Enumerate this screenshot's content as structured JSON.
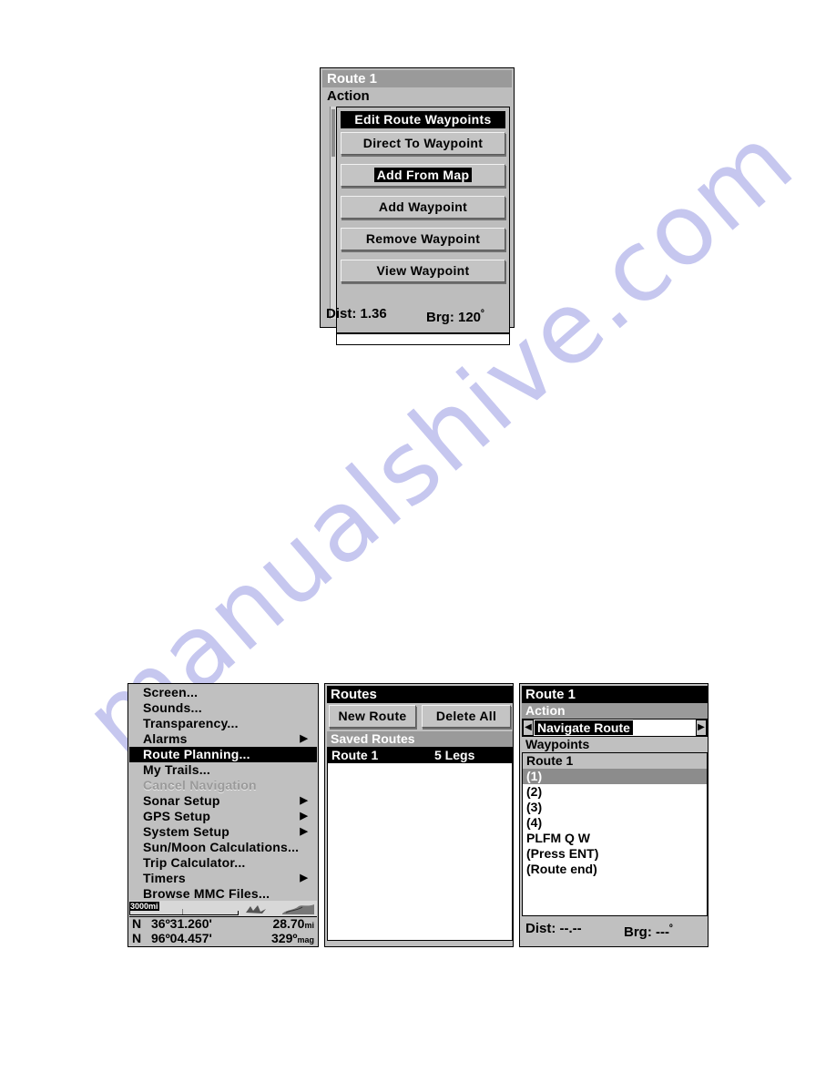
{
  "watermark": {
    "text": "manualshive.com"
  },
  "colors": {
    "lcd_background": "#c0c0c0",
    "selected_black": "#000000",
    "header_gray": "#9a9a9a",
    "row_gray": "#8c8c8c",
    "button_face": "#c4c4c4",
    "watermark_purple": "#c6c7ef"
  },
  "route_action_dialog": {
    "title": "Route 1",
    "section_label": "Action",
    "menu_items": [
      {
        "label": "Edit Route Waypoints",
        "style": "selected"
      },
      {
        "label": "Direct To Waypoint",
        "style": "button"
      },
      {
        "label": "Add From Map",
        "style": "button-inverted"
      },
      {
        "label": "Add Waypoint",
        "style": "button"
      },
      {
        "label": "Remove Waypoint",
        "style": "button"
      },
      {
        "label": "View Waypoint",
        "style": "button"
      }
    ],
    "status": {
      "dist_label": "Dist:",
      "dist_value": "1.36",
      "brg_label": "Brg:",
      "brg_value": "120",
      "brg_unit": "º"
    }
  },
  "main_menu": {
    "items": [
      {
        "label": "Screen...",
        "selected": false,
        "disabled": false,
        "submenu": false
      },
      {
        "label": "Sounds...",
        "selected": false,
        "disabled": false,
        "submenu": false
      },
      {
        "label": "Transparency...",
        "selected": false,
        "disabled": false,
        "submenu": false
      },
      {
        "label": "Alarms",
        "selected": false,
        "disabled": false,
        "submenu": true
      },
      {
        "label": "Route Planning...",
        "selected": true,
        "disabled": false,
        "submenu": false
      },
      {
        "label": "My Trails...",
        "selected": false,
        "disabled": false,
        "submenu": false
      },
      {
        "label": "Cancel Navigation",
        "selected": false,
        "disabled": true,
        "submenu": false
      },
      {
        "label": "Sonar Setup",
        "selected": false,
        "disabled": false,
        "submenu": true
      },
      {
        "label": "GPS Setup",
        "selected": false,
        "disabled": false,
        "submenu": true
      },
      {
        "label": "System Setup",
        "selected": false,
        "disabled": false,
        "submenu": true
      },
      {
        "label": "Sun/Moon Calculations...",
        "selected": false,
        "disabled": false,
        "submenu": false
      },
      {
        "label": "Trip Calculator...",
        "selected": false,
        "disabled": false,
        "submenu": false
      },
      {
        "label": "Timers",
        "selected": false,
        "disabled": false,
        "submenu": true
      },
      {
        "label": "Browse MMC Files...",
        "selected": false,
        "disabled": false,
        "submenu": false
      }
    ],
    "map_scale": "3000mi",
    "position": {
      "lat_hemisphere": "N",
      "lat_value": "36º31.260'",
      "lon_hemisphere": "N",
      "lon_value": "96º04.457'",
      "distance_value": "28.70",
      "distance_unit": "mi",
      "bearing_value": "329º",
      "bearing_unit": "mag"
    }
  },
  "routes_screen": {
    "title": "Routes",
    "new_route_label": "New Route",
    "delete_all_label": "Delete All",
    "saved_routes_label": "Saved Routes",
    "rows": [
      {
        "name": "Route 1",
        "legs": "5 Legs",
        "selected": true
      }
    ]
  },
  "route_detail_screen": {
    "title": "Route 1",
    "action_label": "Action",
    "action_value": "Navigate Route",
    "left_arrow": "◀",
    "right_arrow": "▶",
    "waypoints_label": "Waypoints",
    "waypoint_rows": [
      {
        "label": "Route 1",
        "kind": "header"
      },
      {
        "label": "(1)",
        "kind": "selected"
      },
      {
        "label": "(2)",
        "kind": "normal"
      },
      {
        "label": "(3)",
        "kind": "normal"
      },
      {
        "label": "(4)",
        "kind": "normal"
      },
      {
        "label": "PLFM Q W",
        "kind": "normal"
      },
      {
        "label": "(Press ENT)",
        "kind": "normal"
      },
      {
        "label": "(Route end)",
        "kind": "normal"
      }
    ],
    "status": {
      "dist_label": "Dist:",
      "dist_value": "--.--",
      "brg_label": "Brg:",
      "brg_value": "---",
      "brg_unit": "º"
    }
  }
}
